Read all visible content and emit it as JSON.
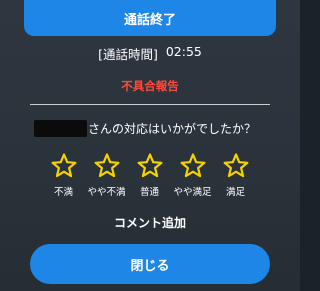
{
  "header": {
    "title": "通話終了"
  },
  "call": {
    "duration_label": "[通話時間]",
    "duration_value": "02:55"
  },
  "report": {
    "label": "不具合報告"
  },
  "survey": {
    "question": "さんの対応はいかがでしたか？",
    "star_color": "#f5d200",
    "options": [
      {
        "label": "不満",
        "icon": "star-icon"
      },
      {
        "label": "やや不満",
        "icon": "star-icon"
      },
      {
        "label": "普通",
        "icon": "star-icon"
      },
      {
        "label": "やや満足",
        "icon": "star-icon"
      },
      {
        "label": "満足",
        "icon": "star-icon"
      }
    ]
  },
  "comment": {
    "label": "コメント追加"
  },
  "footer": {
    "close_label": "閉じる"
  },
  "colors": {
    "accent": "#1e86e6",
    "alert": "#ff4a3d",
    "background": "#2a323a"
  }
}
